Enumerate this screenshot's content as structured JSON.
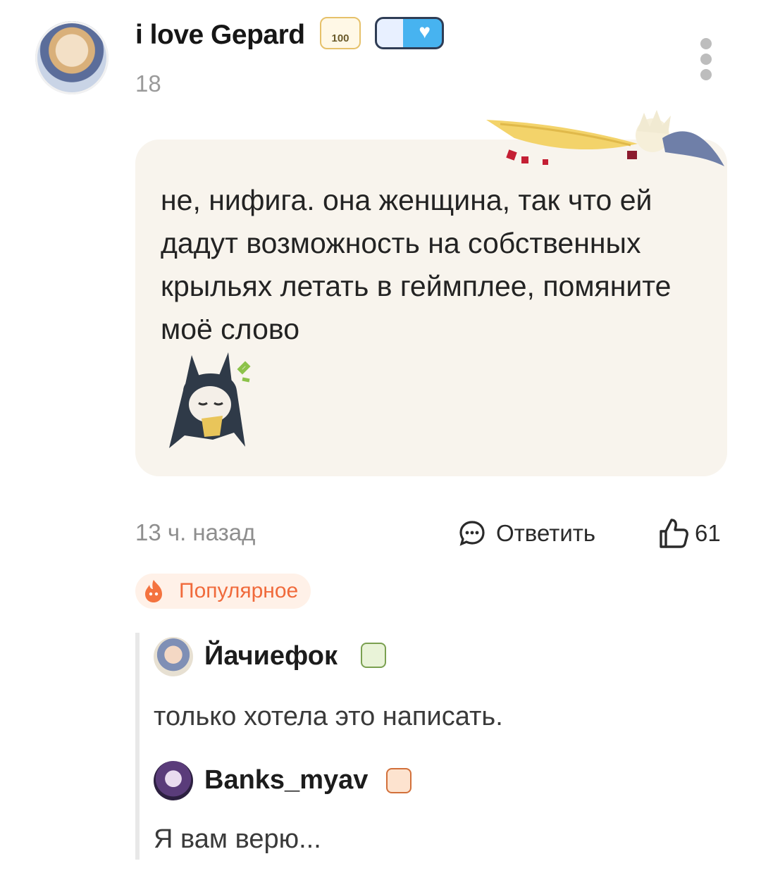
{
  "comment": {
    "author_name": "i love Gepard",
    "author_subtitle": "18",
    "level_badge_text": "100",
    "text": "не, нифига. она женщина, так что ей дадут возможность на собственных крыльях летать в геймплее, помяните моё слово",
    "time": "13 ч. назад",
    "reply_label": "Ответить",
    "likes": "61",
    "popular_label": "Популярное"
  },
  "replies": [
    {
      "author_name": "Йачиефок",
      "text": "только хотела это написать."
    },
    {
      "author_name": "Banks_myav",
      "text": "Я вам верю..."
    }
  ],
  "icons": {
    "more": "more-vertical-icon",
    "reply": "comment-bubble-icon",
    "like": "thumbs-up-icon",
    "popular": "flame-icon"
  },
  "colors": {
    "bubble_bg": "#f8f4ed",
    "popular_accent": "#f06a3b",
    "popular_bg": "#fff1e8",
    "muted_text": "#8e8e8e"
  }
}
